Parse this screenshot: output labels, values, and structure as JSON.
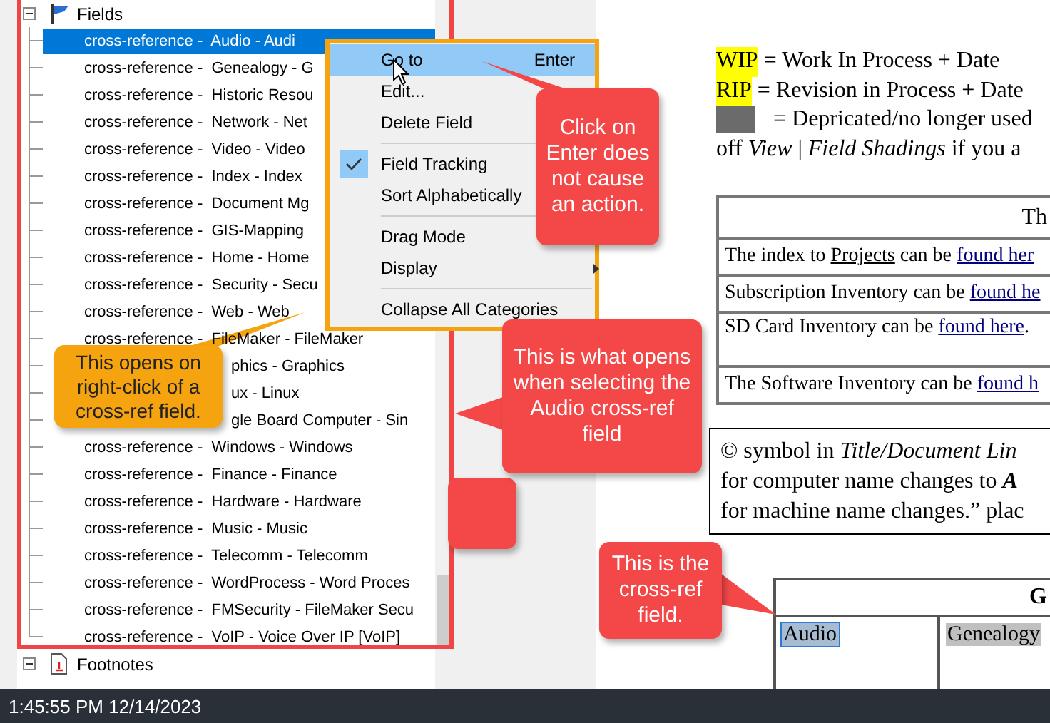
{
  "navigator": {
    "groups": [
      {
        "label": "Fields",
        "expanded": true,
        "children": [
          {
            "label": "cross-reference -  Audio - Audi",
            "selected": true,
            "kind": "full"
          },
          {
            "label": "cross-reference -  Genealogy - G",
            "selected": false,
            "kind": "full"
          },
          {
            "label": "cross-reference -  Historic Resou",
            "selected": false,
            "kind": "full"
          },
          {
            "label": "cross-reference -  Network - Net",
            "selected": false,
            "kind": "full"
          },
          {
            "label": "cross-reference -  Video - Video",
            "selected": false,
            "kind": "full"
          },
          {
            "label": "cross-reference -  Index - Index",
            "selected": false,
            "kind": "full"
          },
          {
            "label": "cross-reference -  Document Mg",
            "selected": false,
            "kind": "full"
          },
          {
            "label": "cross-reference -  GIS-Mapping",
            "selected": false,
            "kind": "full"
          },
          {
            "label": "cross-reference -  Home - Home",
            "selected": false,
            "kind": "full"
          },
          {
            "label": "cross-reference -  Security - Secu",
            "selected": false,
            "kind": "full"
          },
          {
            "label": "cross-reference -  Web - Web",
            "selected": false,
            "kind": "full"
          },
          {
            "label": "cross-reference -  FileMaker - FileMaker",
            "selected": false,
            "kind": "full"
          },
          {
            "label": "phics - Graphics",
            "selected": false,
            "kind": "covered"
          },
          {
            "label": "ux - Linux",
            "selected": false,
            "kind": "covered"
          },
          {
            "label": "gle Board Computer - Sin",
            "selected": false,
            "kind": "covered"
          },
          {
            "label": "cross-reference -  Windows - Windows",
            "selected": false,
            "kind": "full"
          },
          {
            "label": "cross-reference -  Finance - Finance",
            "selected": false,
            "kind": "full"
          },
          {
            "label": "cross-reference -  Hardware - Hardware",
            "selected": false,
            "kind": "full"
          },
          {
            "label": "cross-reference -  Music - Music",
            "selected": false,
            "kind": "full"
          },
          {
            "label": "cross-reference -  Telecomm - Telecomm",
            "selected": false,
            "kind": "full"
          },
          {
            "label": "cross-reference -  WordProcess - Word Proces",
            "selected": false,
            "kind": "full"
          },
          {
            "label": "cross-reference -  FMSecurity - FileMaker Secu",
            "selected": false,
            "kind": "full"
          },
          {
            "label": "cross-reference -  VoIP - Voice Over IP [VoIP]",
            "selected": false,
            "kind": "full"
          }
        ]
      },
      {
        "label": "Footnotes",
        "expanded": true
      }
    ]
  },
  "context_menu": {
    "items": [
      {
        "kind": "item",
        "label": "Go to",
        "shortcut": "Enter",
        "selected": true,
        "checked": false
      },
      {
        "kind": "item",
        "label": "Edit...",
        "selected": false,
        "checked": false
      },
      {
        "kind": "item",
        "label": "Delete Field",
        "selected": false,
        "checked": false
      },
      {
        "kind": "separator"
      },
      {
        "kind": "item",
        "label": "Field Tracking",
        "selected": false,
        "checked": true
      },
      {
        "kind": "item",
        "label": "Sort Alphabetically",
        "selected": false,
        "checked": false
      },
      {
        "kind": "separator"
      },
      {
        "kind": "item",
        "label": "Drag Mode",
        "selected": false,
        "checked": false
      },
      {
        "kind": "submenu",
        "label": "Display",
        "selected": false,
        "checked": false
      },
      {
        "kind": "separator"
      },
      {
        "kind": "item",
        "label": "Collapse All Categories",
        "selected": false,
        "checked": false
      }
    ]
  },
  "callouts": [
    {
      "text": "Click on Enter does not cause an action.",
      "color": "#f44848"
    },
    {
      "text": "This opens on right-click of a cross-ref field.",
      "color": "#f5a30f"
    },
    {
      "text": "This is what opens when selecting the Audio cross-ref field",
      "color": "#f44848"
    },
    {
      "text": "This is the cross-ref field.",
      "color": "#f44848"
    }
  ],
  "document": {
    "legend": [
      {
        "color": "#ffff00",
        "label": "WIP",
        "text": " = Work In Process + Date"
      },
      {
        "color": "#ffff00",
        "label": "RIP",
        "text": " = Revision in Process + Date"
      },
      {
        "color": "#6b6b6b",
        "text": " = Depricated/no longer used"
      },
      {
        "parts": [
          {
            "kind": "plain",
            "text": "off "
          },
          {
            "kind": "italic",
            "text": "View"
          },
          {
            "kind": "plain",
            "text": " | "
          },
          {
            "kind": "italic",
            "text": "Field Shadings"
          },
          {
            "kind": "plain",
            "text": " if you a"
          }
        ]
      }
    ],
    "index_table": {
      "heading": "Th",
      "rows": [
        {
          "parts": [
            {
              "kind": "plain",
              "text": "The index to "
            },
            {
              "kind": "underline",
              "text": "Projects"
            },
            {
              "kind": "plain",
              "text": " can be "
            },
            {
              "kind": "link",
              "text": "found her"
            }
          ]
        },
        {
          "parts": [
            {
              "kind": "plain",
              "text": "Subscription Inventory can be "
            },
            {
              "kind": "link",
              "text": "found he"
            }
          ]
        },
        {
          "parts": [
            {
              "kind": "plain",
              "text": "SD Card Inventory can be "
            },
            {
              "kind": "link",
              "text": "found here"
            },
            {
              "kind": "plain",
              "text": "."
            }
          ]
        },
        {
          "parts": [
            {
              "kind": "plain",
              "text": "The Software Inventory can be "
            },
            {
              "kind": "link",
              "text": "found h"
            }
          ]
        }
      ]
    },
    "note": [
      [
        {
          "kind": "plain",
          "text": "© symbol in "
        },
        {
          "kind": "italic",
          "text": "Title/Document Lin"
        }
      ],
      [
        {
          "kind": "plain",
          "text": "for computer name changes to "
        },
        {
          "kind": "bold_italic",
          "text": "A"
        }
      ],
      [
        {
          "kind": "plain",
          "text": "for machine name changes.” plac"
        }
      ]
    ],
    "category_table": {
      "heading": "G",
      "cells": [
        {
          "text": "Audio",
          "selected": true
        },
        {
          "text": "Genealogy",
          "selected": false
        }
      ]
    }
  },
  "status_bar": {
    "text": "1:45:55 PM 12/14/2023"
  }
}
